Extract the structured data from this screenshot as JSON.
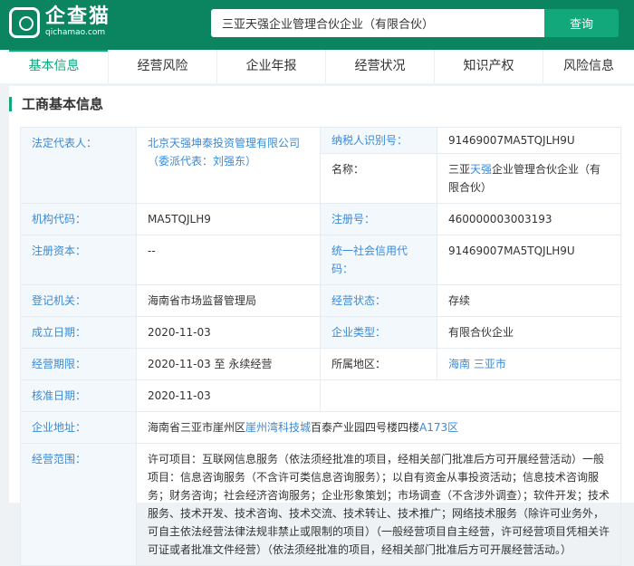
{
  "header": {
    "logo_name": "企查猫",
    "logo_url": "qichamao.com",
    "search_value": "三亚天强企业管理合伙企业（有限合伙）",
    "search_button": "查询"
  },
  "tabs": [
    "基本信息",
    "经营风险",
    "企业年报",
    "经营状况",
    "知识产权",
    "风险信息"
  ],
  "section_title": "工商基本信息",
  "info": {
    "legal_rep_label": "法定代表人：",
    "legal_rep": "北京天强坤泰投资管理有限公司（委派代表：刘强东）",
    "tax_id_label": "纳税人识别号：",
    "tax_id": "91469007MA5TQJLH9U",
    "name_label": "名称：",
    "name_pre": "三亚",
    "name_link": "天强",
    "name_post": "企业管理合伙企业（有限合伙）",
    "org_code_label": "机构代码：",
    "org_code": "MA5TQJLH9",
    "reg_no_label": "注册号：",
    "reg_no": "460000003003193",
    "capital_label": "注册资本：",
    "capital": "--",
    "credit_code_label": "统一社会信用代码：",
    "credit_code": "91469007MA5TQJLH9U",
    "authority_label": "登记机关：",
    "authority": "海南省市场监督管理局",
    "status_label": "经营状态：",
    "status": "存续",
    "founded_label": "成立日期：",
    "founded": "2020-11-03",
    "type_label": "企业类型：",
    "type": "有限合伙企业",
    "term_label": "经营期限：",
    "term": "2020-11-03 至 永续经营",
    "region_label": "所属地区：",
    "region_province": "海南",
    "region_city": "三亚市",
    "approved_label": "核准日期：",
    "approved": "2020-11-03",
    "address_label": "企业地址：",
    "address_pre": "海南省三亚市崖州区",
    "address_link": "崖州湾科技城",
    "address_mid": "百泰产业园四号楼四楼",
    "address_link2": "A173区",
    "scope_label": "经营范围：",
    "scope": "许可项目：互联网信息服务（依法须经批准的项目，经相关部门批准后方可开展经营活动）一般项目：信息咨询服务（不含许可类信息咨询服务）；以自有资金从事投资活动；信息技术咨询服务；财务咨询；社会经济咨询服务；企业形象策划；市场调查（不含涉外调查）；软件开发；技术服务、技术开发、技术咨询、技术交流、技术转让、技术推广；网络技术服务（除许可业务外，可自主依法经营法律法规非禁止或限制的项目）（一般经营项目自主经营，许可经营项目凭相关许可证或者批准文件经营）（依法须经批准的项目，经相关部门批准后方可开展经营活动。）"
  }
}
